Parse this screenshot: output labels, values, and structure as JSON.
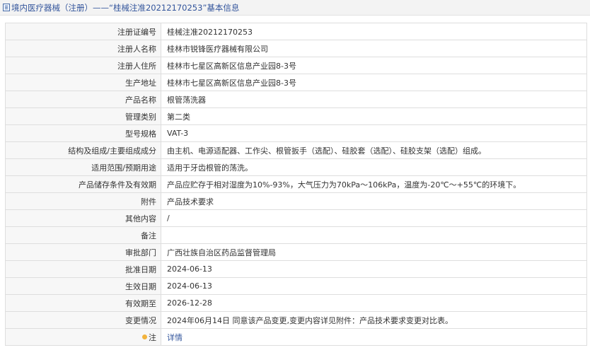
{
  "header": {
    "title": "境内医疗器械（注册）——“桂械注准20212170253”基本信息",
    "icon": "document-icon"
  },
  "rows": [
    {
      "label": "注册证编号",
      "value": "桂械注准20212170253"
    },
    {
      "label": "注册人名称",
      "value": "桂林市锐锋医疗器械有限公司"
    },
    {
      "label": "注册人住所",
      "value": "桂林市七星区高新区信息产业园8-3号"
    },
    {
      "label": "生产地址",
      "value": "桂林市七星区高新区信息产业园8-3号"
    },
    {
      "label": "产品名称",
      "value": "根管荡洗器"
    },
    {
      "label": "管理类别",
      "value": "第二类"
    },
    {
      "label": "型号规格",
      "value": "VAT-3"
    },
    {
      "label": "结构及组成/主要组成成分",
      "value": "由主机、电源适配器、工作尖、根管扳手（选配）、硅胶套（选配）、硅胶支架（选配）组成。"
    },
    {
      "label": "适用范围/预期用途",
      "value": "适用于牙齿根管的荡洗。"
    },
    {
      "label": "产品储存条件及有效期",
      "value": "产品应贮存于相对湿度为10%-93%，大气压力为70kPa～106kPa，温度为-20℃～+55℃的环境下。"
    },
    {
      "label": "附件",
      "value": "产品技术要求"
    },
    {
      "label": "其他内容",
      "value": "/"
    },
    {
      "label": "备注",
      "value": ""
    },
    {
      "label": "审批部门",
      "value": "广西壮族自治区药品监督管理局"
    },
    {
      "label": "批准日期",
      "value": "2024-06-13"
    },
    {
      "label": "生效日期",
      "value": "2024-06-13"
    },
    {
      "label": "有效期至",
      "value": "2026-12-28"
    },
    {
      "label": "变更情况",
      "value": "2024年06月14日 同意该产品变更,变更内容详见附件：产品技术要求变更对比表。"
    }
  ],
  "note_row": {
    "label": "注",
    "link": "详情",
    "icon": "pin-icon"
  }
}
